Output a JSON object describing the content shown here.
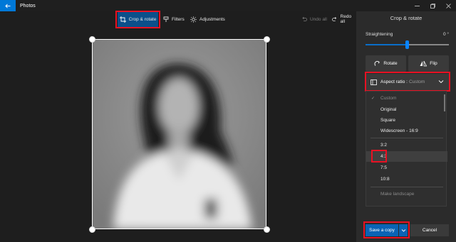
{
  "window": {
    "app_title": "Photos"
  },
  "toolbar": {
    "crop_rotate_label": "Crop & rotate",
    "filters_label": "Filters",
    "adjustments_label": "Adjustments",
    "undo_label": "Undo all",
    "redo_label": "Redo all"
  },
  "panel": {
    "title": "Crop & rotate",
    "straightening_label": "Straightening",
    "straightening_value": "0 °",
    "straightening_level": 0.5,
    "rotate_label": "Rotate",
    "flip_label": "Flip",
    "aspect_label": "Aspect ratio :",
    "aspect_value": "Custom",
    "save_label": "Save a copy",
    "cancel_label": "Cancel"
  },
  "aspect_menu": {
    "items": [
      {
        "label": "Custom",
        "state": "checked"
      },
      {
        "label": "Original",
        "state": "normal"
      },
      {
        "label": "Square",
        "state": "normal"
      },
      {
        "label": "Widescreen - 16:9",
        "state": "normal"
      },
      {
        "label": "3:2",
        "state": "normal"
      },
      {
        "label": "4:3",
        "state": "highlighted"
      },
      {
        "label": "7:5",
        "state": "normal"
      },
      {
        "label": "10:8",
        "state": "normal"
      },
      {
        "label": "Make landscape",
        "state": "disabled"
      }
    ]
  },
  "colors": {
    "accent": "#0078d7",
    "highlight_box": "#e81123"
  }
}
